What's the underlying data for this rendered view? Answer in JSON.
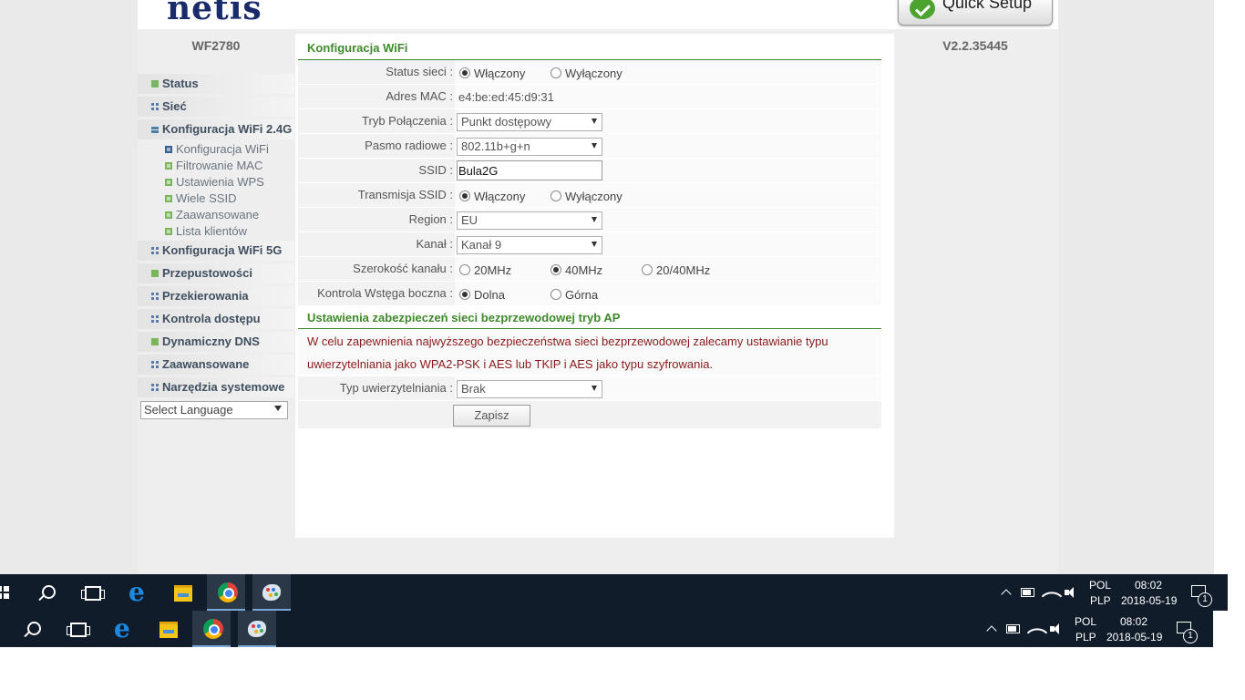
{
  "header": {
    "logo": "netis",
    "quick_setup": "Quick Setup"
  },
  "sidebar": {
    "model": "WF2780",
    "items": [
      {
        "label": "Status"
      },
      {
        "label": "Sieć"
      },
      {
        "label": "Konfiguracja WiFi 2.4G"
      },
      {
        "label": "Konfiguracja WiFi 5G"
      },
      {
        "label": "Przepustowości"
      },
      {
        "label": "Przekierowania"
      },
      {
        "label": "Kontrola dostępu"
      },
      {
        "label": "Dynamiczny DNS"
      },
      {
        "label": "Zaawansowane"
      },
      {
        "label": "Narzędzia systemowe"
      }
    ],
    "subitems": [
      {
        "label": "Konfiguracja WiFi"
      },
      {
        "label": "Filtrowanie MAC"
      },
      {
        "label": "Ustawienia WPS"
      },
      {
        "label": "Wiele SSID"
      },
      {
        "label": "Zaawansowane"
      },
      {
        "label": "Lista klientów"
      }
    ],
    "language": "Select Language"
  },
  "version": "V2.2.35445",
  "wifi": {
    "title": "Konfiguracja WiFi",
    "status": {
      "label": "Status sieci :",
      "on": "Włączony",
      "off": "Wyłączony",
      "selected": "on"
    },
    "mac": {
      "label": "Adres MAC :",
      "value": "e4:be:ed:45:d9:31"
    },
    "mode": {
      "label": "Tryb Połączenia :",
      "value": "Punkt dostępowy"
    },
    "band": {
      "label": "Pasmo radiowe :",
      "value": "802.11b+g+n"
    },
    "ssid": {
      "label": "SSID :",
      "value": "Bula2G"
    },
    "broadcast": {
      "label": "Transmisja SSID :",
      "on": "Włączony",
      "off": "Wyłączony",
      "selected": "on"
    },
    "region": {
      "label": "Region :",
      "value": "EU"
    },
    "channel": {
      "label": "Kanał :",
      "value": "Kanał 9"
    },
    "width": {
      "label": "Szerokość kanału :",
      "opt1": "20MHz",
      "opt2": "40MHz",
      "opt3": "20/40MHz",
      "selected": "40MHz"
    },
    "sideband": {
      "label": "Kontrola Wstęga boczna :",
      "opt1": "Dolna",
      "opt2": "Górna",
      "selected": "Dolna"
    }
  },
  "security": {
    "title": "Ustawienia zabezpieczeń sieci bezprzewodowej tryb AP",
    "warning_line1": "W celu zapewnienia najwyższego bezpieczeństwa sieci bezprzewodowej zalecamy ustawianie typu",
    "warning_line2": "uwierzytelniania jako WPA2-PSK i AES lub TKIP i AES jako typu szyfrowania.",
    "auth": {
      "label": "Typ uwierzytelniania :",
      "value": "Brak"
    },
    "save": "Zapisz"
  },
  "taskbars": [
    {
      "lang": "POL",
      "layout": "PLP",
      "time": "08:02",
      "date": "2018-05-19",
      "notifications": "1"
    },
    {
      "lang": "POL",
      "layout": "PLP",
      "time": "08:02",
      "date": "2018-05-19",
      "notifications": "1"
    }
  ]
}
